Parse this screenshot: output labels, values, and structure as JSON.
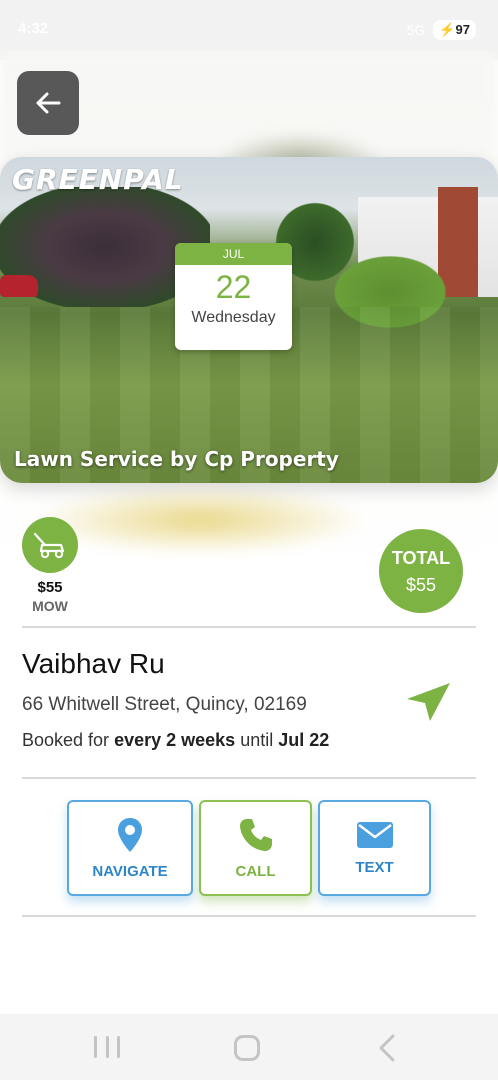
{
  "status_bar": {
    "time": "4:32",
    "network": "5G",
    "battery": "97"
  },
  "hero": {
    "brand_logo": "GREENPAL",
    "caption": "Lawn Service by Cp Property",
    "date": {
      "month": "JUL",
      "day": "22",
      "weekday": "Wednesday"
    }
  },
  "service": {
    "icon": "lawn-mower-icon",
    "price": "$55",
    "name": "MOW"
  },
  "total": {
    "label": "TOTAL",
    "value": "$55"
  },
  "customer": {
    "name": "Vaibhav Ru",
    "address": "66 Whitwell Street, Quincy, 02169",
    "booked_prefix": "Booked for",
    "booked_frequency": "every 2 weeks",
    "booked_until_word": "until",
    "booked_until_date": "Jul 22"
  },
  "actions": [
    {
      "label": "NAVIGATE",
      "icon": "map-pin-icon"
    },
    {
      "label": "CALL",
      "icon": "phone-icon"
    },
    {
      "label": "TEXT",
      "icon": "envelope-icon"
    }
  ],
  "colors": {
    "brand_green": "#7cb342",
    "action_blue": "#2e86c9"
  }
}
